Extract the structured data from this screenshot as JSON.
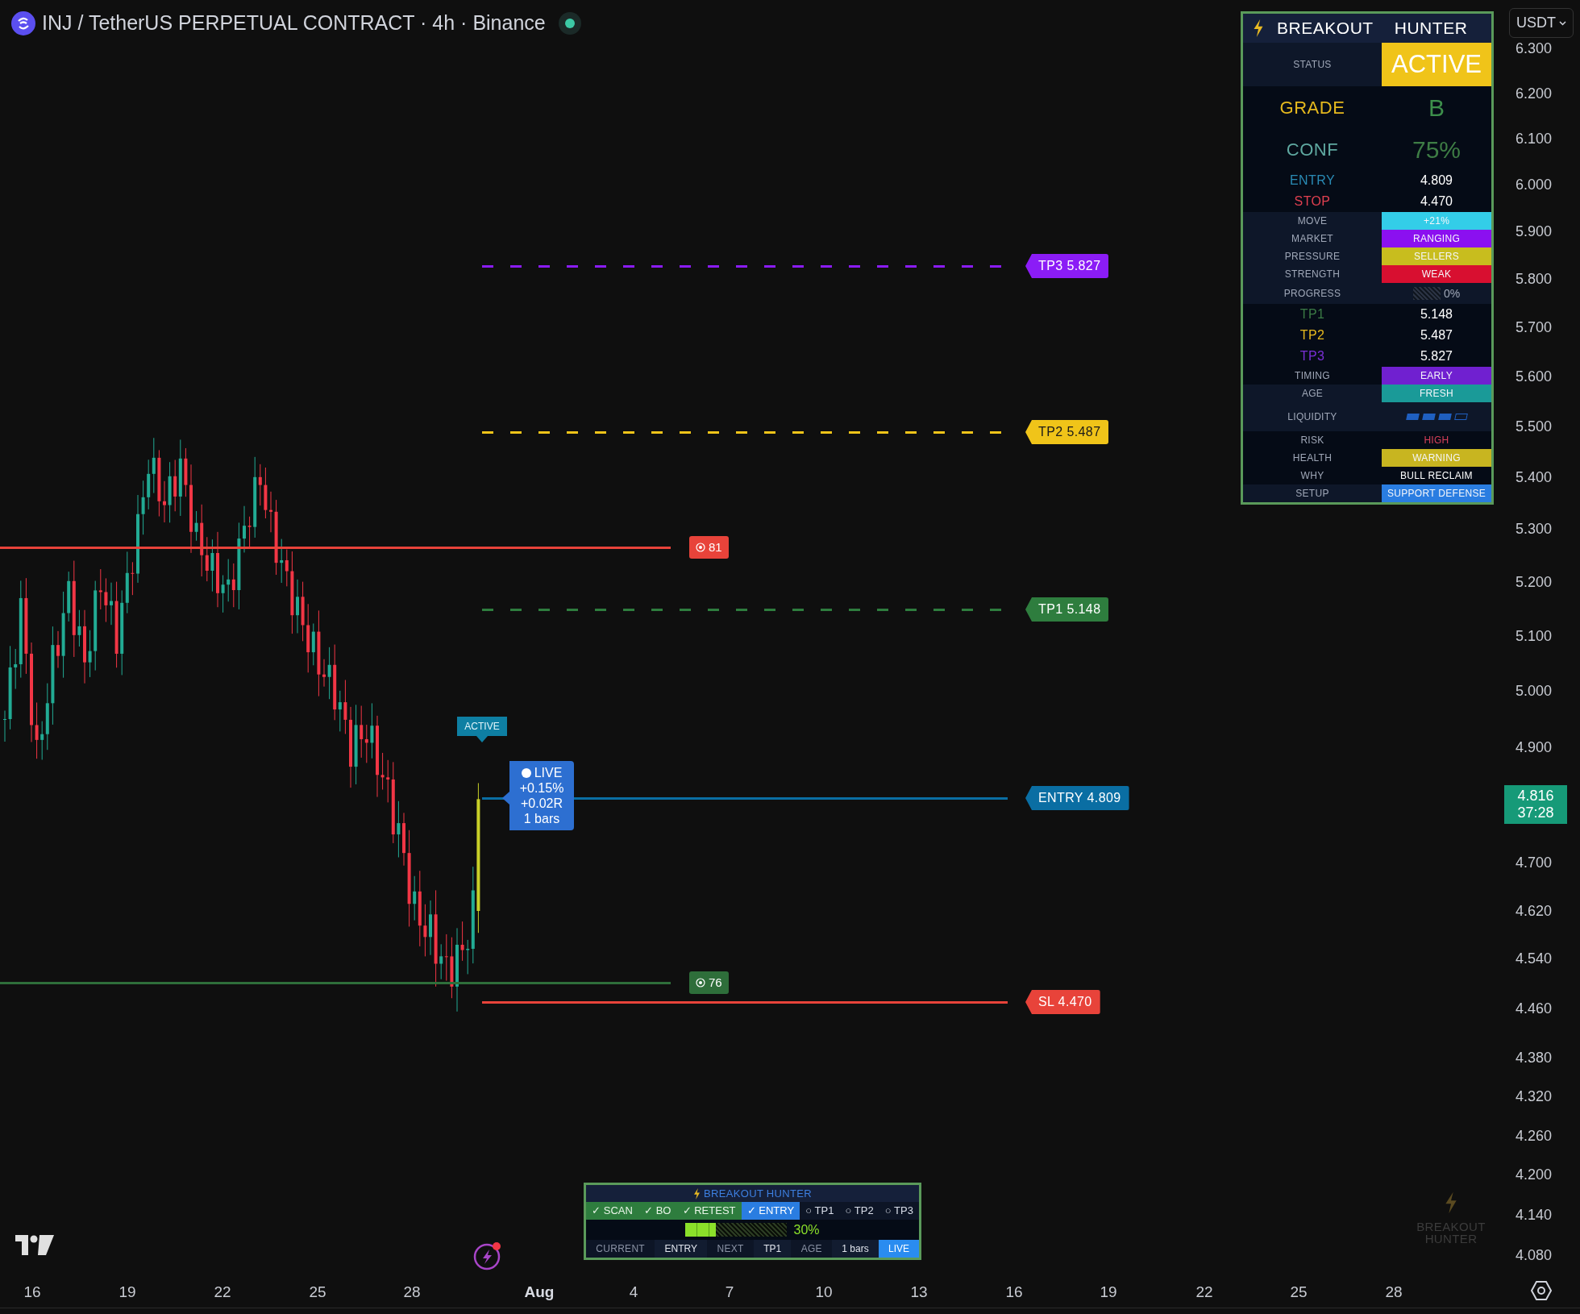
{
  "header": {
    "title": "INJ / TetherUS PERPETUAL CONTRACT · 4h · Binance",
    "market_open": true
  },
  "currency": "USDT",
  "price_axis": [
    "6.300",
    "6.200",
    "6.100",
    "6.000",
    "5.900",
    "5.800",
    "5.700",
    "5.600",
    "5.500",
    "5.400",
    "5.300",
    "5.200",
    "5.100",
    "5.000",
    "4.900",
    "4.700",
    "4.620",
    "4.540",
    "4.460",
    "4.380",
    "4.320",
    "4.260",
    "4.200",
    "4.140",
    "4.080"
  ],
  "current_price": {
    "price": "4.816",
    "countdown": "37:28"
  },
  "time_axis": [
    {
      "label": "16",
      "bold": false
    },
    {
      "label": "19",
      "bold": false
    },
    {
      "label": "22",
      "bold": false
    },
    {
      "label": "25",
      "bold": false
    },
    {
      "label": "28",
      "bold": false
    },
    {
      "label": "Aug",
      "bold": true
    },
    {
      "label": "4",
      "bold": false
    },
    {
      "label": "7",
      "bold": false
    },
    {
      "label": "10",
      "bold": false
    },
    {
      "label": "13",
      "bold": false
    },
    {
      "label": "16",
      "bold": false
    },
    {
      "label": "19",
      "bold": false
    },
    {
      "label": "22",
      "bold": false
    },
    {
      "label": "25",
      "bold": false
    },
    {
      "label": "28",
      "bold": false
    }
  ],
  "levels": [
    {
      "text": "TP3 5.827",
      "color": "#8b1cf6",
      "dashed": true,
      "dark_text": false
    },
    {
      "text": "TP2 5.487",
      "color": "#f0c419",
      "dashed": true,
      "dark_text": true
    },
    {
      "text": "TP1 5.148",
      "color": "#2e7d3e",
      "dashed": true,
      "dark_text": false
    },
    {
      "text": "ENTRY 4.809",
      "color": "#0a6ea3",
      "dashed": false,
      "dark_text": false
    },
    {
      "text": "SL 4.470",
      "color": "#e8433a",
      "dashed": false,
      "dark_text": false
    }
  ],
  "zones": [
    {
      "value": "81",
      "color": "#e8433a"
    },
    {
      "value": "76",
      "color": "#2e6e3a"
    }
  ],
  "status_badge": "ACTIVE",
  "live_callout": [
    "LIVE",
    "+0.15%",
    "+0.02R",
    "1 bars"
  ],
  "panel": {
    "title": [
      "BREAKOUT",
      "HUNTER"
    ],
    "rows": [
      {
        "kind": "status",
        "shaded": true,
        "label": {
          "text": "STATUS"
        },
        "value": {
          "text": "ACTIVE",
          "color": "#f0c419"
        }
      },
      {
        "kind": "big",
        "shaded": false,
        "label": {
          "text": "GRADE",
          "color": "#e6b91e"
        },
        "value": {
          "text": "B",
          "color": "#3d8f4b"
        }
      },
      {
        "kind": "big",
        "shaded": false,
        "label": {
          "text": "CONF",
          "color": "#5fa8a0"
        },
        "value": {
          "text": "75%",
          "color": "#3e7d45"
        }
      },
      {
        "kind": "value",
        "shaded": false,
        "label": {
          "text": "ENTRY",
          "color": "#2a8bb5"
        },
        "value": {
          "text": "4.809"
        }
      },
      {
        "kind": "value",
        "shaded": false,
        "label": {
          "text": "STOP",
          "color": "#e04050"
        },
        "value": {
          "text": "4.470"
        }
      },
      {
        "kind": "badge",
        "shaded": true,
        "label": {
          "text": "MOVE"
        },
        "value": {
          "text": "+21%",
          "color": "#33cde8"
        }
      },
      {
        "kind": "badge",
        "shaded": true,
        "label": {
          "text": "MARKET"
        },
        "value": {
          "text": "RANGING",
          "color": "#8b10f0"
        }
      },
      {
        "kind": "badge",
        "shaded": true,
        "label": {
          "text": "PRESSURE"
        },
        "value": {
          "text": "SELLERS",
          "color": "#c8bd1e"
        }
      },
      {
        "kind": "badge",
        "shaded": true,
        "label": {
          "text": "STRENGTH"
        },
        "value": {
          "text": "WEAK",
          "color": "#d80f30"
        }
      },
      {
        "kind": "progress",
        "shaded": true,
        "label": {
          "text": "PROGRESS"
        },
        "level": 0,
        "reading": "0%"
      },
      {
        "kind": "value",
        "shaded": false,
        "label": {
          "text": "TP1",
          "color": "#3b7a45"
        },
        "value": {
          "text": "5.148"
        }
      },
      {
        "kind": "value",
        "shaded": false,
        "label": {
          "text": "TP2",
          "color": "#e6b91e"
        },
        "value": {
          "text": "5.487"
        }
      },
      {
        "kind": "value",
        "shaded": false,
        "label": {
          "text": "TP3",
          "color": "#7a2fd6"
        },
        "value": {
          "text": "5.827"
        }
      },
      {
        "kind": "badge",
        "shaded": false,
        "label": {
          "text": "TIMING"
        },
        "value": {
          "text": "EARLY",
          "color": "#7020d0"
        }
      },
      {
        "kind": "badge",
        "shaded": true,
        "label": {
          "text": "AGE"
        },
        "value": {
          "text": "FRESH",
          "color": "#1a9a98"
        }
      },
      {
        "kind": "meter",
        "shaded": true,
        "label": {
          "text": "LIQUIDITY"
        },
        "level": 0.75
      },
      {
        "kind": "text",
        "shaded": false,
        "label": {
          "text": "RISK"
        },
        "value": {
          "text": "HIGH",
          "color": "#d8405a"
        }
      },
      {
        "kind": "badge",
        "shaded": false,
        "label": {
          "text": "HEALTH"
        },
        "value": {
          "text": "WARNING",
          "color": "#c8b520"
        }
      },
      {
        "kind": "text",
        "shaded": false,
        "label": {
          "text": "WHY"
        },
        "value": {
          "text": "BULL RECLAIM",
          "color": "#ffffff"
        }
      },
      {
        "kind": "badge",
        "shaded": true,
        "label": {
          "text": "SETUP"
        },
        "value": {
          "text": "SUPPORT DEFENSE",
          "color": "#2a7de1"
        }
      }
    ]
  },
  "tracker": {
    "title": "BREAKOUT HUNTER",
    "steps": [
      {
        "label": "✓ SCAN",
        "done": true,
        "selected": false
      },
      {
        "label": "✓ BO",
        "done": true,
        "selected": false
      },
      {
        "label": "✓ RETEST",
        "done": true,
        "selected": false
      },
      {
        "label": "✓ ENTRY",
        "done": true,
        "selected": true
      },
      {
        "label": "○ TP1",
        "done": false,
        "selected": false
      },
      {
        "label": "○ TP2",
        "done": false,
        "selected": false
      },
      {
        "label": "○ TP3",
        "done": false,
        "selected": false
      }
    ],
    "level": 0.3,
    "reading": "30%",
    "footer": [
      {
        "label": "CURRENT",
        "value": "ENTRY"
      },
      {
        "label": "NEXT",
        "value": "TP1"
      },
      {
        "label": "AGE",
        "value": "1 bars"
      }
    ],
    "live": "LIVE"
  },
  "watermark": [
    "BREAKOUT",
    "HUNTER"
  ]
}
